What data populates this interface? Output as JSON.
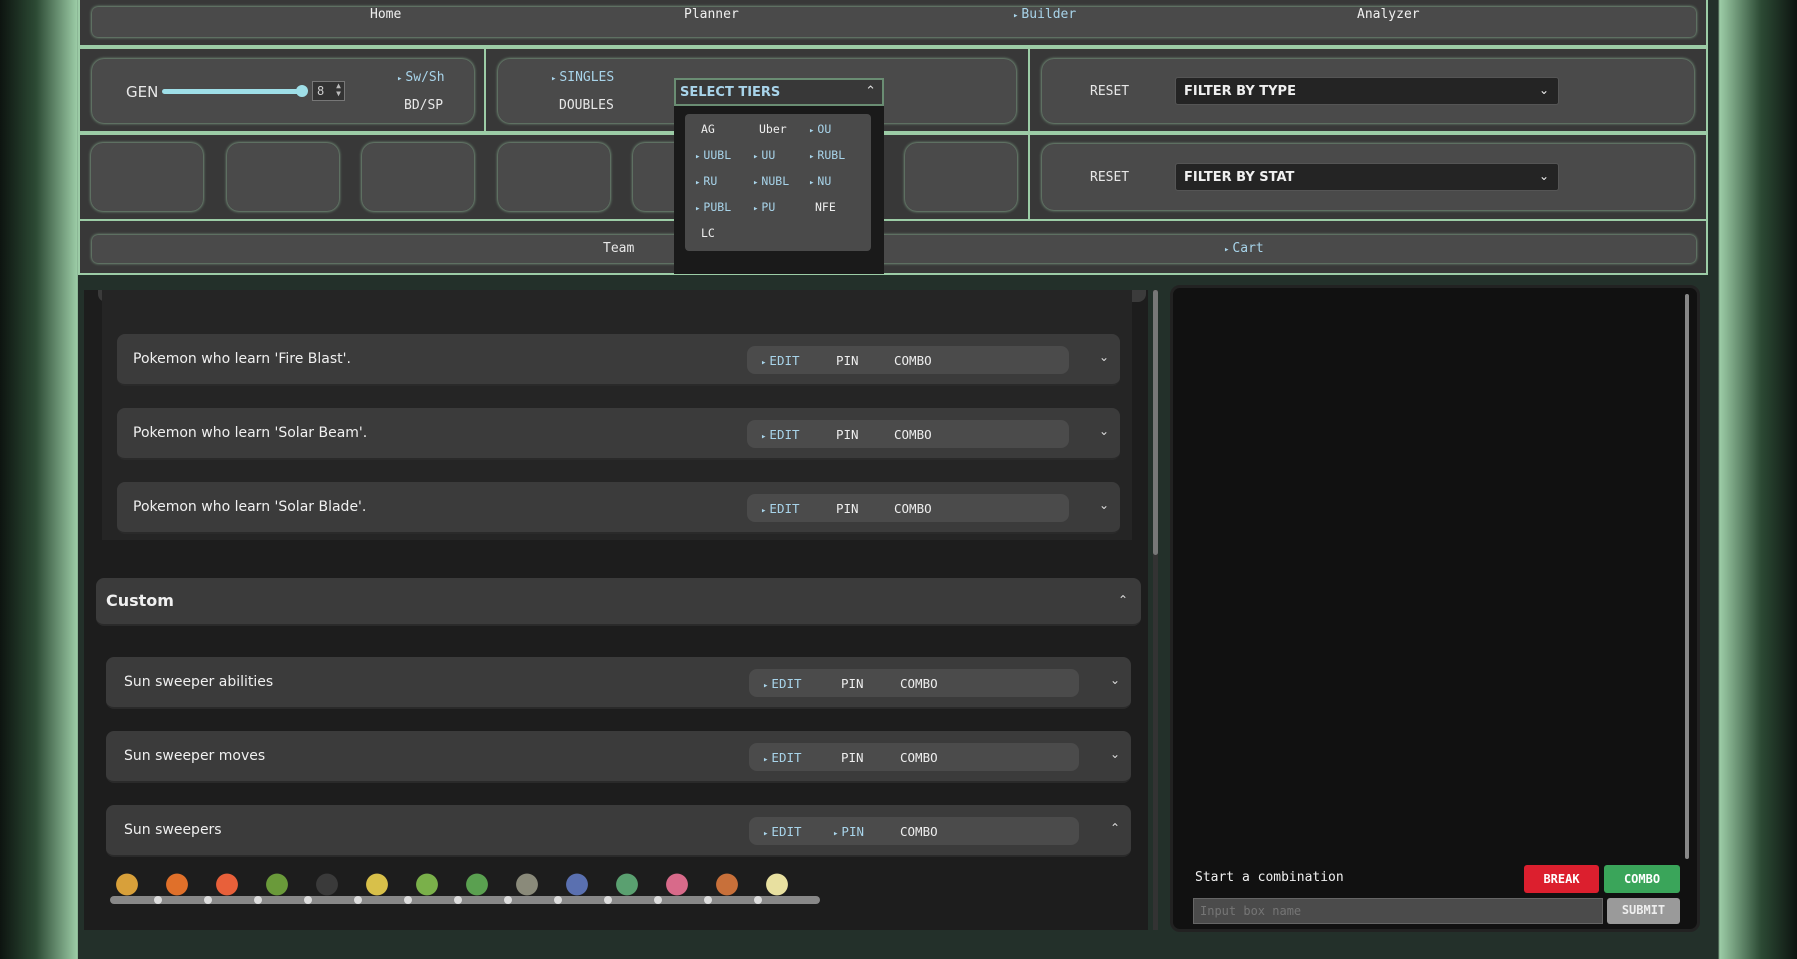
{
  "nav": {
    "items": [
      {
        "label": "Home",
        "active": false
      },
      {
        "label": "Planner",
        "active": false
      },
      {
        "label": "Builder",
        "active": true
      },
      {
        "label": "Analyzer",
        "active": false
      }
    ]
  },
  "gen": {
    "label": "GEN",
    "value": "8",
    "slider_level": 1.0,
    "games": [
      {
        "label": "Sw/Sh",
        "selected": true
      },
      {
        "label": "BD/SP",
        "selected": false
      }
    ]
  },
  "format": {
    "options": [
      {
        "label": "SINGLES",
        "selected": true
      },
      {
        "label": "DOUBLES",
        "selected": false
      }
    ]
  },
  "tiers": {
    "header": "SELECT TIERS",
    "header_icon": "chevron-up-icon",
    "items": [
      {
        "label": "AG",
        "selected": false
      },
      {
        "label": "Uber",
        "selected": false
      },
      {
        "label": "OU",
        "selected": true
      },
      {
        "label": "UUBL",
        "selected": true
      },
      {
        "label": "UU",
        "selected": true
      },
      {
        "label": "RUBL",
        "selected": true
      },
      {
        "label": "RU",
        "selected": true
      },
      {
        "label": "NUBL",
        "selected": true
      },
      {
        "label": "NU",
        "selected": true
      },
      {
        "label": "PUBL",
        "selected": true
      },
      {
        "label": "PU",
        "selected": true
      },
      {
        "label": "NFE",
        "selected": false
      },
      {
        "label": "LC",
        "selected": false
      }
    ]
  },
  "filters": {
    "type": {
      "reset": "RESET",
      "value": "FILTER BY TYPE"
    },
    "stat": {
      "reset": "RESET",
      "value": "FILTER BY STAT"
    }
  },
  "tabs2": [
    {
      "label": "Team",
      "active": false
    },
    {
      "label": "Cart",
      "active": true
    }
  ],
  "move_rows": [
    {
      "title": "Pokemon who learn 'Fire Blast'.",
      "edit": "EDIT",
      "pin": "PIN",
      "combo": "COMBO"
    },
    {
      "title": "Pokemon who learn 'Solar Beam'.",
      "edit": "EDIT",
      "pin": "PIN",
      "combo": "COMBO"
    },
    {
      "title": "Pokemon who learn 'Solar Blade'.",
      "edit": "EDIT",
      "pin": "PIN",
      "combo": "COMBO"
    }
  ],
  "custom": {
    "title": "Custom",
    "rows": [
      {
        "title": "Sun sweeper abilities",
        "edit": "EDIT",
        "pin": "PIN",
        "combo": "COMBO",
        "pin_selected": false,
        "expanded": false
      },
      {
        "title": "Sun sweeper moves",
        "edit": "EDIT",
        "pin": "PIN",
        "combo": "COMBO",
        "pin_selected": false,
        "expanded": false
      },
      {
        "title": "Sun sweepers",
        "edit": "EDIT",
        "pin": "PIN",
        "combo": "COMBO",
        "pin_selected": true,
        "expanded": true
      }
    ]
  },
  "sprites": {
    "colors": [
      "#d8a03a",
      "#e0702a",
      "#e8603a",
      "#6a9a3a",
      "#3a3a3a",
      "#d8c04a",
      "#7ab04a",
      "#5aa050",
      "#8a8a7a",
      "#5a70b0",
      "#5aa070",
      "#d86a8a",
      "#c8703a",
      "#e8e0a0"
    ]
  },
  "combination": {
    "prompt": "Start a combination",
    "break_label": "BREAK",
    "combo_label": "COMBO",
    "input_placeholder": "Input box name",
    "submit_label": "SUBMIT",
    "colors": {
      "break": "#dc1f2e",
      "combo": "#3aa55a",
      "submit": "#9a9a9a"
    }
  }
}
